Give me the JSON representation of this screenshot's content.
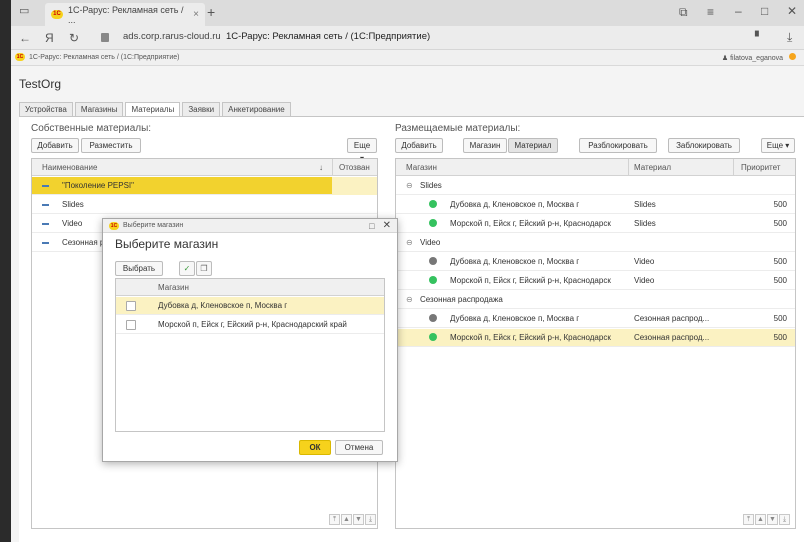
{
  "browser": {
    "tab_title": "1С-Рарус: Рекламная сеть / ...",
    "tab_close": "×",
    "new_tab": "+",
    "nav_back": "←",
    "nav_yandex": "Я",
    "nav_reload": "↻",
    "url_domain": "ads.corp.rarus-cloud.ru",
    "url_title": "1С-Рарус: Рекламная сеть / (1С:Предприятие)",
    "bookmark_text": "1С-Рарус: Рекламная сеть / (1С:Предприятие)",
    "user": "filatova_eganova"
  },
  "app": {
    "org": "TestOrg",
    "tabs": [
      "Устройства",
      "Магазины",
      "Материалы",
      "Заявки",
      "Анкетирование"
    ]
  },
  "left": {
    "title": "Собственные материалы:",
    "btn_add": "Добавить",
    "btn_place": "Разместить",
    "btn_more": "Еще ▾",
    "col_name": "Наименование",
    "col_sort": "↓",
    "col_revoked": "Отозван",
    "rows": [
      "\"Поколение PEPSI\"",
      "Slides",
      "Video",
      "Сезонная распродажа"
    ]
  },
  "right": {
    "title": "Размещаемые материалы:",
    "btn_add": "Добавить",
    "btn_shop": "Магазин",
    "btn_material": "Материал",
    "btn_unblock": "Разблокировать",
    "btn_block": "Заблокировать",
    "btn_more": "Еще ▾",
    "col_shop": "Магазин",
    "col_material": "Материал",
    "col_priority": "Приоритет",
    "groups": [
      {
        "name": "Slides",
        "items": [
          {
            "shop": "Дубовка д, Кленовское п, Москва г",
            "material": "Slides",
            "priority": "500",
            "status": "green"
          },
          {
            "shop": "Морской п, Ейск г, Ейский р-н, Краснодарск",
            "material": "Slides",
            "priority": "500",
            "status": "green"
          }
        ]
      },
      {
        "name": "Video",
        "items": [
          {
            "shop": "Дубовка д, Кленовское п, Москва г",
            "material": "Video",
            "priority": "500",
            "status": "gray"
          },
          {
            "shop": "Морской п, Ейск г, Ейский р-н, Краснодарск",
            "material": "Video",
            "priority": "500",
            "status": "green"
          }
        ]
      },
      {
        "name": "Сезонная распродажа",
        "items": [
          {
            "shop": "Дубовка д, Кленовское п, Москва г",
            "material": "Сезонная распрод...",
            "priority": "500",
            "status": "gray"
          },
          {
            "shop": "Морской п, Ейск г, Ейский р-н, Краснодарск",
            "material": "Сезонная распрод...",
            "priority": "500",
            "status": "green"
          }
        ]
      }
    ]
  },
  "modal": {
    "window_title": "Выберите магазин",
    "heading": "Выберите магазин",
    "btn_select": "Выбрать",
    "col_shop": "Магазин",
    "rows": [
      "Дубовка д, Кленовское п, Москва г",
      "Морской п, Ейск г, Ейский р-н, Краснодарский край"
    ],
    "btn_ok": "ОК",
    "btn_cancel": "Отмена"
  },
  "colors": {
    "selected": "#f2d22e",
    "highlight": "#fbf2c2",
    "ok": "#f6d21c",
    "status_green": "#35c25f",
    "status_gray": "#777777"
  }
}
